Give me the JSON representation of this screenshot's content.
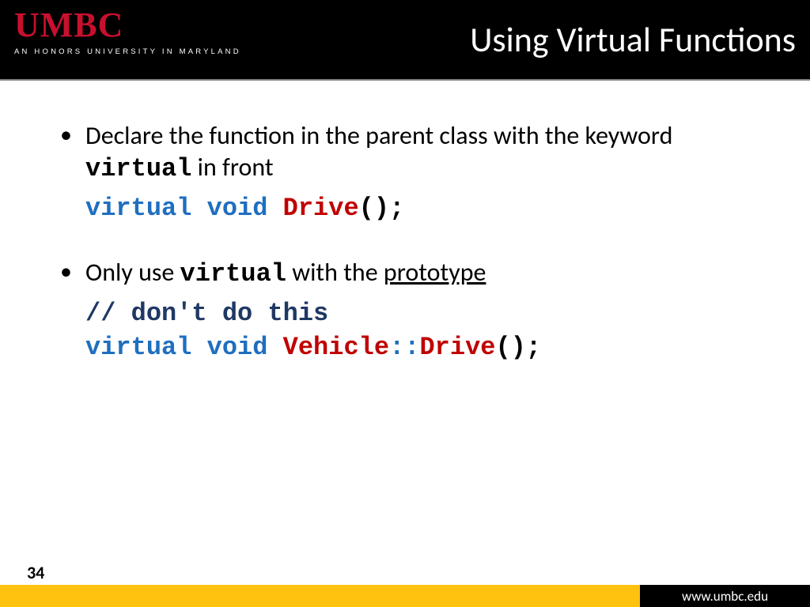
{
  "header": {
    "logo_main": "UMBC",
    "logo_tag": "AN HONORS UNIVERSITY IN MARYLAND",
    "title": "Using Virtual Functions"
  },
  "body": {
    "bullet1_pre": "Declare the function in the parent class with the keyword ",
    "bullet1_kw": "virtual",
    "bullet1_post": " in front",
    "code1_kw1": "virtual",
    "code1_kw2": "void",
    "code1_fn": "Drive",
    "code1_tail": "();",
    "bullet2_pre": "Only use ",
    "bullet2_kw": "virtual",
    "bullet2_mid": " with the ",
    "bullet2_ul": "prototype",
    "code2_comment": "// don't do this",
    "code2_kw1": "virtual",
    "code2_kw2": "void",
    "code2_cls": "Vehicle",
    "code2_sep": "::",
    "code2_fn": "Drive",
    "code2_tail": "();"
  },
  "footer": {
    "slide_number": "34",
    "url": "www.umbc.edu"
  }
}
